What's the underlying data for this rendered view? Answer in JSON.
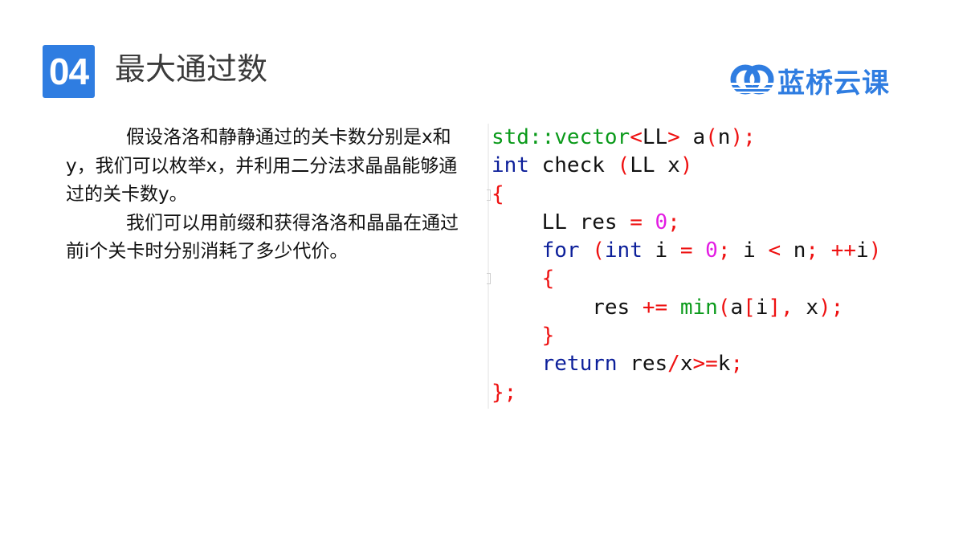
{
  "header": {
    "section_number": "04",
    "title": "最大通过数",
    "logo_text": "蓝桥云课",
    "logo_icon": "lanqiao-logo-icon",
    "accent_color": "#2f7de1"
  },
  "body": {
    "paragraphs": [
      "假设洛洛和静静通过的关卡数分别是x和y，我们可以枚举x，并利用二分法求晶晶能够通过的关卡数y。",
      "我们可以用前缀和获得洛洛和晶晶在通过前i个关卡时分别消耗了多少代价。"
    ]
  },
  "code": {
    "language": "cpp",
    "lines": [
      [
        {
          "t": "std::vector",
          "c": "std"
        },
        {
          "t": "<",
          "c": "op"
        },
        {
          "t": "LL",
          "c": ""
        },
        {
          "t": ">",
          "c": "op"
        },
        {
          "t": " a",
          "c": ""
        },
        {
          "t": "(",
          "c": "op"
        },
        {
          "t": "n",
          "c": ""
        },
        {
          "t": ");",
          "c": "op"
        }
      ],
      [
        {
          "t": "int",
          "c": "kw"
        },
        {
          "t": " check ",
          "c": ""
        },
        {
          "t": "(",
          "c": "op"
        },
        {
          "t": "LL x",
          "c": ""
        },
        {
          "t": ")",
          "c": "op"
        }
      ],
      [
        {
          "t": "{",
          "c": "op"
        }
      ],
      [
        {
          "t": "    LL res ",
          "c": ""
        },
        {
          "t": "=",
          "c": "op"
        },
        {
          "t": " ",
          "c": ""
        },
        {
          "t": "0",
          "c": "num"
        },
        {
          "t": ";",
          "c": "op"
        }
      ],
      [
        {
          "t": "    ",
          "c": ""
        },
        {
          "t": "for",
          "c": "kw"
        },
        {
          "t": " ",
          "c": ""
        },
        {
          "t": "(",
          "c": "op"
        },
        {
          "t": "int",
          "c": "kw"
        },
        {
          "t": " i ",
          "c": ""
        },
        {
          "t": "=",
          "c": "op"
        },
        {
          "t": " ",
          "c": ""
        },
        {
          "t": "0",
          "c": "num"
        },
        {
          "t": ";",
          "c": "op"
        },
        {
          "t": " i ",
          "c": ""
        },
        {
          "t": "<",
          "c": "op"
        },
        {
          "t": " n",
          "c": ""
        },
        {
          "t": ";",
          "c": "op"
        },
        {
          "t": " ",
          "c": ""
        },
        {
          "t": "++",
          "c": "op"
        },
        {
          "t": "i",
          "c": ""
        },
        {
          "t": ")",
          "c": "op"
        }
      ],
      [
        {
          "t": "    ",
          "c": ""
        },
        {
          "t": "{",
          "c": "op"
        }
      ],
      [
        {
          "t": "        res ",
          "c": ""
        },
        {
          "t": "+=",
          "c": "op"
        },
        {
          "t": " ",
          "c": ""
        },
        {
          "t": "min",
          "c": "std"
        },
        {
          "t": "(",
          "c": "op"
        },
        {
          "t": "a",
          "c": ""
        },
        {
          "t": "[",
          "c": "op"
        },
        {
          "t": "i",
          "c": ""
        },
        {
          "t": "],",
          "c": "op"
        },
        {
          "t": " x",
          "c": ""
        },
        {
          "t": ");",
          "c": "op"
        }
      ],
      [
        {
          "t": "    ",
          "c": ""
        },
        {
          "t": "}",
          "c": "op"
        }
      ],
      [
        {
          "t": "    ",
          "c": ""
        },
        {
          "t": "return",
          "c": "kw"
        },
        {
          "t": " res",
          "c": ""
        },
        {
          "t": "/",
          "c": "op"
        },
        {
          "t": "x",
          "c": ""
        },
        {
          "t": ">=",
          "c": "op"
        },
        {
          "t": "k",
          "c": ""
        },
        {
          "t": ";",
          "c": "op"
        }
      ],
      [
        {
          "t": "};",
          "c": "op"
        }
      ]
    ]
  }
}
